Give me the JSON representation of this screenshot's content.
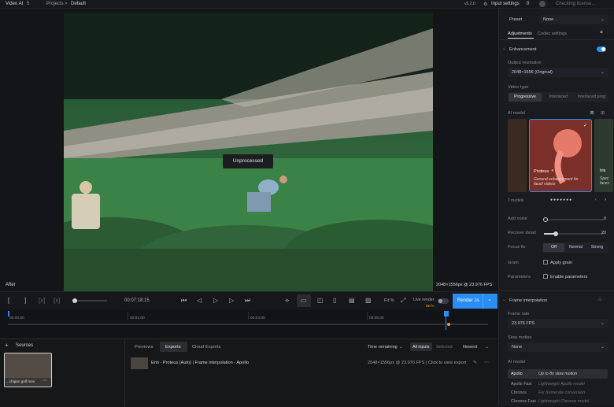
{
  "app": {
    "title": "Video AI",
    "version_badge": "5",
    "breadcrumb_projects": "Projects",
    "breadcrumb_sep": ">",
    "breadcrumb_current": "Default",
    "version": "v5.2.0",
    "input_settings": "Input settings",
    "notifications": "0",
    "license": "Checking license..."
  },
  "viewer": {
    "unprocessed": "Unprocessed",
    "after_label": "After",
    "resolution": "2048×1556px @ 23.976 FPS"
  },
  "controls": {
    "timecode": "00:07:18:15",
    "fit": "Fit %",
    "live_render": "Live render",
    "live_badge": "BETA",
    "render_label": "Render 1s",
    "render_more": "⌄"
  },
  "timeline": {
    "ticks": [
      "00:00:00",
      "00:02:00",
      "00:04:00",
      "00:06:00"
    ]
  },
  "bottom": {
    "sources_label": "Sources",
    "source_file": "...chigan golf.mov",
    "tabs": [
      "Previews",
      "Exports",
      "Cloud Exports"
    ],
    "active_tab": "Exports",
    "sort_label": "Time remaining",
    "filter_all": "All inputs",
    "filter_selected": "Selected",
    "order": "Newest",
    "export_title": "Enh - Proteus (Auto) | Frame interpolation - Apollo",
    "export_info": "2048×1556px @ 23.976 FPS | Click to view export"
  },
  "sidebar": {
    "preset_label": "Preset",
    "preset_value": "None",
    "tab_adjustments": "Adjustments",
    "tab_codec": "Codec settings",
    "enhancement": "Enhancement",
    "output_resolution_label": "Output resolution",
    "output_resolution_value": "2048×1556 (Original)",
    "video_type_label": "Video type",
    "video_types": [
      "Progressive",
      "Interlaced",
      "Interlaced prog"
    ],
    "ai_model_label": "AI model",
    "model_name": "Proteus",
    "model_desc": "General enhancement for faceil videos",
    "model_side": "Iris",
    "model_side_desc": "Spec faces",
    "model_count": "7 models",
    "add_noise_label": "Add noise",
    "add_noise_value": "0",
    "recover_detail_label": "Recover detail",
    "recover_detail_value": "20",
    "focus_fix_label": "Focus fix",
    "focus_options": [
      "Off",
      "Normal",
      "Strong"
    ],
    "grain_label": "Grain",
    "apply_grain": "Apply grain",
    "parameters_label": "Parameters",
    "enable_parameters": "Enable parameters",
    "frame_interp": "Frame interpolation",
    "frame_rate_label": "Frame rate",
    "frame_rate_value": "23.976 FPS",
    "slow_motion_label": "Slow motion",
    "slow_motion_value": "None",
    "ai_model2_label": "AI model",
    "fi_models": [
      {
        "name": "Apollo",
        "desc": "Up to 8x slow motion"
      },
      {
        "name": "Apollo Fast",
        "desc": "Lightweight Apollo model"
      },
      {
        "name": "Chronos",
        "desc": "For framerate conversion"
      },
      {
        "name": "Chronos Fast",
        "desc": "Lightweight Chronos model"
      }
    ]
  },
  "colors": {
    "accent": "#2a8df5",
    "orange": "#f0a020"
  }
}
